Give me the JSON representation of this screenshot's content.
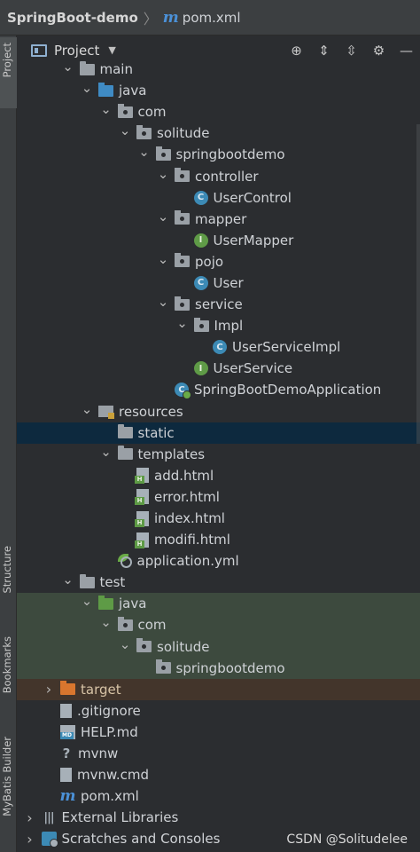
{
  "breadcrumb": {
    "project": "SpringBoot-demo",
    "separator": "〉",
    "file": "pom.xml"
  },
  "tool_strip": {
    "project": "Project",
    "structure": "Structure",
    "bookmarks": "Bookmarks",
    "mybatis": "MyBatis Builder"
  },
  "project_view": {
    "title": "Project"
  },
  "tree": [
    {
      "label": "main",
      "arrow": "expanded",
      "icon": "folder",
      "depth": 3
    },
    {
      "label": "java",
      "arrow": "expanded",
      "icon": "source-folder",
      "depth": 4
    },
    {
      "label": "com",
      "arrow": "expanded",
      "icon": "package",
      "depth": 5
    },
    {
      "label": "solitude",
      "arrow": "expanded",
      "icon": "package",
      "depth": 6
    },
    {
      "label": "springbootdemo",
      "arrow": "expanded",
      "icon": "package",
      "depth": 7
    },
    {
      "label": "controller",
      "arrow": "expanded",
      "icon": "package",
      "depth": 8
    },
    {
      "label": "UserControl",
      "arrow": "none",
      "icon": "class",
      "depth": 9
    },
    {
      "label": "mapper",
      "arrow": "expanded",
      "icon": "package",
      "depth": 8
    },
    {
      "label": "UserMapper",
      "arrow": "none",
      "icon": "interface",
      "depth": 9
    },
    {
      "label": "pojo",
      "arrow": "expanded",
      "icon": "package",
      "depth": 8
    },
    {
      "label": "User",
      "arrow": "none",
      "icon": "class",
      "depth": 9
    },
    {
      "label": "service",
      "arrow": "expanded",
      "icon": "package",
      "depth": 8
    },
    {
      "label": "Impl",
      "arrow": "expanded",
      "icon": "package",
      "depth": 9
    },
    {
      "label": "UserServiceImpl",
      "arrow": "none",
      "icon": "class",
      "depth": 10
    },
    {
      "label": "UserService",
      "arrow": "none",
      "icon": "interface",
      "depth": 9
    },
    {
      "label": "SpringBootDemoApplication",
      "arrow": "none",
      "icon": "spring-class",
      "depth": 8
    },
    {
      "label": "resources",
      "arrow": "expanded",
      "icon": "resources-folder",
      "depth": 4
    },
    {
      "label": "static",
      "arrow": "none",
      "icon": "folder",
      "depth": 5,
      "state": "selected"
    },
    {
      "label": "templates",
      "arrow": "expanded",
      "icon": "folder",
      "depth": 5
    },
    {
      "label": "add.html",
      "arrow": "none",
      "icon": "html-file",
      "depth": 6
    },
    {
      "label": "error.html",
      "arrow": "none",
      "icon": "html-file",
      "depth": 6
    },
    {
      "label": "index.html",
      "arrow": "none",
      "icon": "html-file",
      "depth": 6
    },
    {
      "label": "modifi.html",
      "arrow": "none",
      "icon": "html-file",
      "depth": 6
    },
    {
      "label": "application.yml",
      "arrow": "none",
      "icon": "yml-file",
      "depth": 5
    },
    {
      "label": "test",
      "arrow": "expanded",
      "icon": "folder",
      "depth": 3
    },
    {
      "label": "java",
      "arrow": "expanded",
      "icon": "test-folder",
      "depth": 4,
      "state": "test"
    },
    {
      "label": "com",
      "arrow": "expanded",
      "icon": "package",
      "depth": 5,
      "state": "test"
    },
    {
      "label": "solitude",
      "arrow": "expanded",
      "icon": "package",
      "depth": 6,
      "state": "test"
    },
    {
      "label": "springbootdemo",
      "arrow": "none",
      "icon": "package",
      "depth": 7,
      "state": "test"
    },
    {
      "label": "target",
      "arrow": "collapsed",
      "icon": "excluded-folder",
      "depth": 2,
      "state": "excluded"
    },
    {
      "label": ".gitignore",
      "arrow": "none",
      "icon": "gitignore-file",
      "depth": 2
    },
    {
      "label": "HELP.md",
      "arrow": "none",
      "icon": "md-file",
      "depth": 2
    },
    {
      "label": "mvnw",
      "arrow": "none",
      "icon": "unknown-file",
      "depth": 2
    },
    {
      "label": "mvnw.cmd",
      "arrow": "none",
      "icon": "text-file",
      "depth": 2
    },
    {
      "label": "pom.xml",
      "arrow": "none",
      "icon": "maven-file",
      "depth": 2
    },
    {
      "label": "External Libraries",
      "arrow": "collapsed",
      "icon": "libraries",
      "depth": 1
    },
    {
      "label": "Scratches and Consoles",
      "arrow": "collapsed",
      "icon": "scratches",
      "depth": 1
    }
  ],
  "watermark": "CSDN @Solitudelee",
  "colors": {
    "selection": "#0d293e",
    "test_bg": "#3d4a3e",
    "excluded_bg": "#43352b",
    "accent": "#4b91d8"
  }
}
